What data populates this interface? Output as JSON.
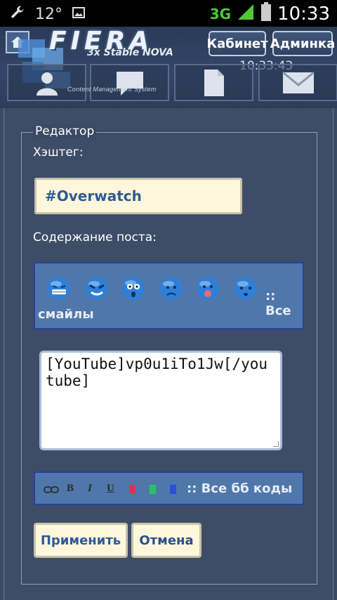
{
  "statusbar": {
    "temperature": "12°",
    "network": "3G",
    "time": "10:33",
    "icons": [
      "wrench-icon",
      "image-icon",
      "signal-icon",
      "battery-icon"
    ]
  },
  "header": {
    "logo_title": "FIERA",
    "logo_subtitle": "3x Stable NOVA",
    "logo_tagline": "Content Management System",
    "cabinet_label": "Кабинет",
    "admin_label": "Админка",
    "clock": "10:33:43",
    "tiles": [
      "user-icon",
      "chat-icon",
      "document-icon",
      "mail-icon"
    ]
  },
  "editor": {
    "legend": "Редактор",
    "hashtag_label": "Хэштег:",
    "hashtag_value": "#Overwatch",
    "content_label": "Содержание поста:",
    "smileys": [
      "grin-smiley",
      "evil-smiley",
      "shocked-smiley",
      "sad-smiley",
      "tongue-smiley",
      "worried-smiley"
    ],
    "smileys_link_1": ":: Все",
    "smileys_link_2": "смайлы",
    "post_text": "[YouTube]vp0u1iTo1Jw[/youtube]",
    "bb_codes": {
      "bold": "B",
      "italic": "I",
      "underline": "U",
      "link_text": ":: Все бб коды"
    },
    "colors": {
      "red": "#d8345a",
      "green": "#27c45a",
      "blue": "#2a4fd8"
    },
    "apply_label": "Применить",
    "cancel_label": "Отмена"
  }
}
